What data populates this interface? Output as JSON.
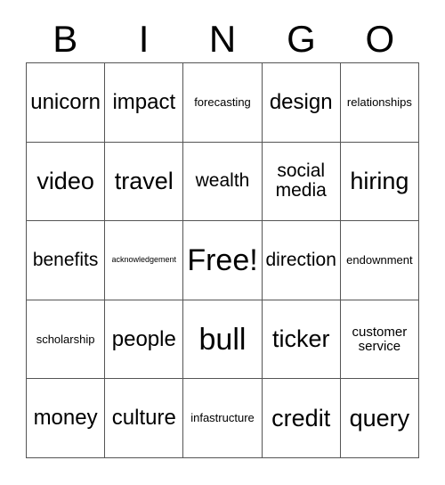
{
  "card": {
    "title": "BINGO",
    "header_letters": [
      "B",
      "I",
      "N",
      "G",
      "O"
    ],
    "columns": 5,
    "rows": 5,
    "free_space_label": "Free!",
    "border_color": "#555555",
    "text_color": "#000000",
    "background_color": "#ffffff",
    "cells": [
      {
        "text": "unicorn",
        "size": "s-l",
        "free": false
      },
      {
        "text": "impact",
        "size": "s-l",
        "free": false
      },
      {
        "text": "forecasting",
        "size": "s-xs",
        "free": false
      },
      {
        "text": "design",
        "size": "s-l",
        "free": false
      },
      {
        "text": "relationships",
        "size": "s-xs",
        "free": false
      },
      {
        "text": "video",
        "size": "s-xl",
        "free": false
      },
      {
        "text": "travel",
        "size": "s-xl",
        "free": false
      },
      {
        "text": "wealth",
        "size": "s-m",
        "free": false
      },
      {
        "text": "social media",
        "size": "s-m",
        "free": false
      },
      {
        "text": "hiring",
        "size": "s-xl",
        "free": false
      },
      {
        "text": "benefits",
        "size": "s-m",
        "free": false
      },
      {
        "text": "acknowledgement",
        "size": "s-xxs",
        "free": false
      },
      {
        "text": "Free!",
        "size": "s-xxl",
        "free": true
      },
      {
        "text": "direction",
        "size": "s-m",
        "free": false
      },
      {
        "text": "endownment",
        "size": "s-xs",
        "free": false
      },
      {
        "text": "scholarship",
        "size": "s-xs",
        "free": false
      },
      {
        "text": "people",
        "size": "s-l",
        "free": false
      },
      {
        "text": "bull",
        "size": "s-xxl",
        "free": false
      },
      {
        "text": "ticker",
        "size": "s-xl",
        "free": false
      },
      {
        "text": "customer service",
        "size": "s-s",
        "free": false
      },
      {
        "text": "money",
        "size": "s-l",
        "free": false
      },
      {
        "text": "culture",
        "size": "s-l",
        "free": false
      },
      {
        "text": "infastructure",
        "size": "s-xs",
        "free": false
      },
      {
        "text": "credit",
        "size": "s-xl",
        "free": false
      },
      {
        "text": "query",
        "size": "s-xl",
        "free": false
      }
    ]
  }
}
